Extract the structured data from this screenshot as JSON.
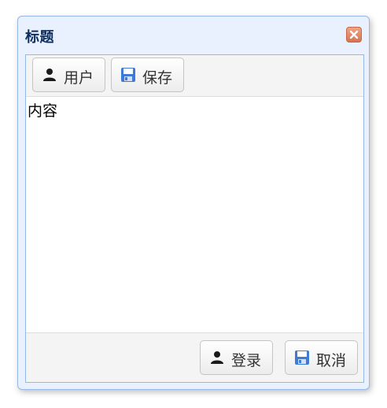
{
  "dialog": {
    "title": "标题",
    "close_icon": "close-icon",
    "accent_color": "#95b8e7",
    "close_color": "#d6734f"
  },
  "toolbar": {
    "buttons": [
      {
        "label": "用户",
        "icon": "user-icon"
      },
      {
        "label": "保存",
        "icon": "save-icon"
      }
    ]
  },
  "content": {
    "text": "内容"
  },
  "footer": {
    "buttons": [
      {
        "label": "登录",
        "icon": "user-icon"
      },
      {
        "label": "取消",
        "icon": "save-icon"
      }
    ]
  }
}
